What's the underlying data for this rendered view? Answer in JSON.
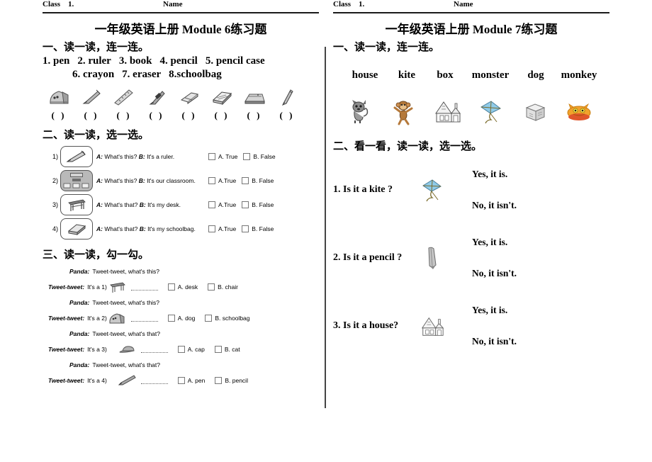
{
  "left": {
    "header": {
      "class_label": "Class",
      "class_value": "1.",
      "name_label": "Name"
    },
    "title": "一年级英语上册 Module 6练习题",
    "section1": {
      "heading": "一、读一读，连一连。",
      "words_line1": [
        "1. pen",
        "2. ruler",
        "3. book",
        "4. pencil",
        "5. pencil case"
      ],
      "words_line2": [
        "6. crayon",
        "7. eraser",
        "8.schoolbag"
      ],
      "pictures": [
        {
          "icon": "schoolbag-icon",
          "paren": "(  )"
        },
        {
          "icon": "pencil-icon",
          "paren": "(  )"
        },
        {
          "icon": "ruler-icon",
          "paren": "(  )"
        },
        {
          "icon": "crayon-icon",
          "paren": "(  )"
        },
        {
          "icon": "eraser-icon",
          "paren": "(  )"
        },
        {
          "icon": "book-icon",
          "paren": "(  )"
        },
        {
          "icon": "pencil-case-icon",
          "paren": "(  )"
        },
        {
          "icon": "pen-icon",
          "paren": "(  )"
        }
      ]
    },
    "section2": {
      "heading": "二、读一读，选一选。",
      "rows": [
        {
          "num": "1)",
          "icon": "pencil-icon",
          "speaker_a": "A:",
          "question": "What's this?",
          "speaker_b": "B:",
          "answer": "It's a ruler.",
          "opt_a": "A. True",
          "opt_b": "B. False"
        },
        {
          "num": "2)",
          "icon": "classroom-icon",
          "speaker_a": "A:",
          "question": "What's this?",
          "speaker_b": "B:",
          "answer": "It's our classroom.",
          "opt_a": "A.True",
          "opt_b": "B. False"
        },
        {
          "num": "3)",
          "icon": "desk-icon",
          "speaker_a": "A:",
          "question": "What's that?",
          "speaker_b": "B:",
          "answer": "It's my desk.",
          "opt_a": "A.True",
          "opt_b": "B. False"
        },
        {
          "num": "4)",
          "icon": "schoolbag-icon",
          "speaker_a": "A:",
          "question": "What's that?",
          "speaker_b": "B:",
          "answer": "It's my schoolbag.",
          "opt_a": "A.True",
          "opt_b": "B. False"
        }
      ]
    },
    "section3": {
      "heading": "三、读一读，勾一勾。",
      "panda_speaker": "Panda:",
      "tweet_speaker": "Tweet-tweet:",
      "items": [
        {
          "panda": "Tweet-tweet, what's this?",
          "tweet": "It's a 1)",
          "icon": "desk-icon",
          "opt_a": "A. desk",
          "opt_b": "B. chair"
        },
        {
          "panda": "Tweet-tweet, what's this?",
          "tweet": "It's a 2)",
          "icon": "schoolbag-icon",
          "opt_a": "A. dog",
          "opt_b": "B. schoolbag"
        },
        {
          "panda": "Tweet-tweet, what's that?",
          "tweet": "It's a 3)",
          "icon": "cap-icon",
          "opt_a": "A. cap",
          "opt_b": "B. cat"
        },
        {
          "panda": "Tweet-tweet, what's that?",
          "tweet": "It's a 4)",
          "icon": "pen-icon",
          "opt_a": "A. pen",
          "opt_b": "B. pencil"
        }
      ]
    }
  },
  "right": {
    "header": {
      "class_label": "Class",
      "class_value": "1.",
      "name_label": "Name"
    },
    "title": "一年级英语上册 Module 7练习题",
    "section1": {
      "heading": "一、读一读，连一连。",
      "words": [
        "house",
        "kite",
        "box",
        "monster",
        "dog",
        "monkey"
      ],
      "pictures": [
        {
          "icon": "dog-icon"
        },
        {
          "icon": "monkey-icon"
        },
        {
          "icon": "house-icon"
        },
        {
          "icon": "kite-icon"
        },
        {
          "icon": "box-icon"
        },
        {
          "icon": "monster-icon"
        }
      ]
    },
    "section2": {
      "heading": "二、看一看，读一读，选一选。",
      "questions": [
        {
          "text": "1. Is it a kite ?",
          "icon": "kite-icon",
          "yes": "Yes, it is.",
          "no": "No, it isn't."
        },
        {
          "text": "2. Is it a pencil ?",
          "icon": "pencil-icon",
          "yes": "Yes, it is.",
          "no": "No, it isn't."
        },
        {
          "text": "3. Is it a house?",
          "icon": "house-icon",
          "yes": "Yes, it is.",
          "no": "No, it isn't."
        }
      ]
    }
  },
  "colors": {
    "ink": "#000000",
    "rule": "#1a1a1a",
    "kite_blue": "#8fcbe8",
    "monster_orange": "#f2a22c",
    "monkey_brown": "#b5793a",
    "gray_art": "#8d8d8d"
  }
}
